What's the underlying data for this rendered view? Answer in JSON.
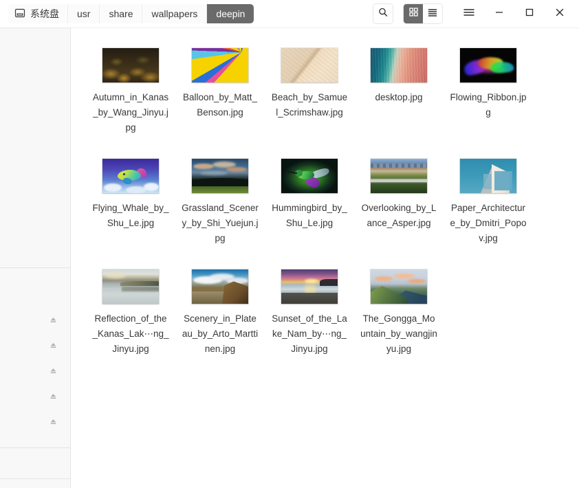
{
  "window": {
    "titlebar": {
      "breadcrumbs": [
        {
          "label": "系统盘",
          "icon": "disk-icon",
          "active": false
        },
        {
          "label": "usr",
          "active": false
        },
        {
          "label": "share",
          "active": false
        },
        {
          "label": "wallpapers",
          "active": false
        },
        {
          "label": "deepin",
          "active": true
        }
      ],
      "search_icon": "search-icon",
      "view_icon_grid": "grid-view-icon",
      "view_icon_list": "list-view-icon",
      "active_view": "grid",
      "menu_icon": "hamburger-menu-icon",
      "minimize_icon": "minimize-icon",
      "maximize_icon": "maximize-icon",
      "close_icon": "close-icon"
    }
  },
  "sidebar": {
    "device_rows": [
      {
        "label": "",
        "eject_icon": "eject-icon"
      },
      {
        "label": "",
        "eject_icon": "eject-icon"
      },
      {
        "label": "",
        "eject_icon": "eject-icon"
      },
      {
        "label": "",
        "eject_icon": "eject-icon"
      },
      {
        "label": "",
        "eject_icon": "eject-icon"
      }
    ]
  },
  "files": {
    "rows": [
      [
        {
          "name": "Autumn_in_Kanas_by_Wang_Jinyu.jpg",
          "art": "t-autumn"
        },
        {
          "name": "Balloon_by_Matt_Benson.jpg",
          "art": "t-balloon"
        },
        {
          "name": "Beach_by_Samuel_Scrimshaw.jpg",
          "art": "t-beach"
        },
        {
          "name": "desktop.jpg",
          "art": "t-desktop"
        },
        {
          "name": "Flowing_Ribbon.jpg",
          "art": "t-ribbon"
        }
      ],
      [
        {
          "name": "Flying_Whale_by_Shu_Le.jpg",
          "art": "t-whale"
        },
        {
          "name": "Grassland_Scenery_by_Shi_Yuejun.jpg",
          "art": "t-grass"
        },
        {
          "name": "Hummingbird_by_Shu_Le.jpg",
          "art": "t-hummer"
        },
        {
          "name": "Overlooking_by_Lance_Asper.jpg",
          "art": "t-overlook"
        },
        {
          "name": "Paper_Architecture_by_Dmitri_Popov.jpg",
          "art": "t-paper"
        }
      ],
      [
        {
          "name": "Reflection_of_the_Kanas_Lak⋯ng_Jinyu.jpg",
          "art": "t-reflect"
        },
        {
          "name": "Scenery_in_Plateau_by_Arto_Marttinen.jpg",
          "art": "t-scenery"
        },
        {
          "name": "Sunset_of_the_Lake_Nam_by⋯ng_Jinyu.jpg",
          "art": "t-sunset"
        },
        {
          "name": "The_Gongga_Mountain_by_wangjinyu.jpg",
          "art": "t-gongga"
        }
      ]
    ]
  },
  "colors": {
    "accent_active_crumb": "#6a6a6a",
    "window_bg": "#ffffff",
    "sidebar_bg": "#f8f8f8",
    "border": "#e4e4e4",
    "text": "#38383a"
  }
}
